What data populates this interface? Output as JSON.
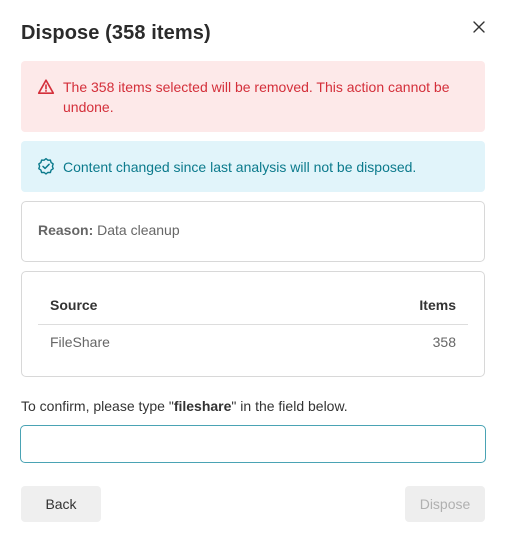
{
  "dialog": {
    "title": "Dispose (358 items)",
    "close_icon": "close-icon"
  },
  "alerts": {
    "error": {
      "icon": "warning-triangle-icon",
      "text": "The 358 items selected will be removed. This action cannot be undone.",
      "color": "#d42f3a",
      "background": "#fde9e9"
    },
    "info": {
      "icon": "check-shield-icon",
      "text": "Content changed since last analysis will not be disposed.",
      "color": "#0b7a8c",
      "background": "#e1f4fa"
    }
  },
  "reason": {
    "label": "Reason:",
    "value": "Data cleanup"
  },
  "table": {
    "headers": {
      "source": "Source",
      "items": "Items"
    },
    "rows": [
      {
        "source": "FileShare",
        "items": "358"
      }
    ]
  },
  "confirm": {
    "prefix": "To confirm, please type \"",
    "keyword": "fileshare",
    "suffix": "\" in the field below.",
    "input_value": "",
    "input_placeholder": ""
  },
  "buttons": {
    "back_label": "Back",
    "dispose_label": "Dispose"
  }
}
